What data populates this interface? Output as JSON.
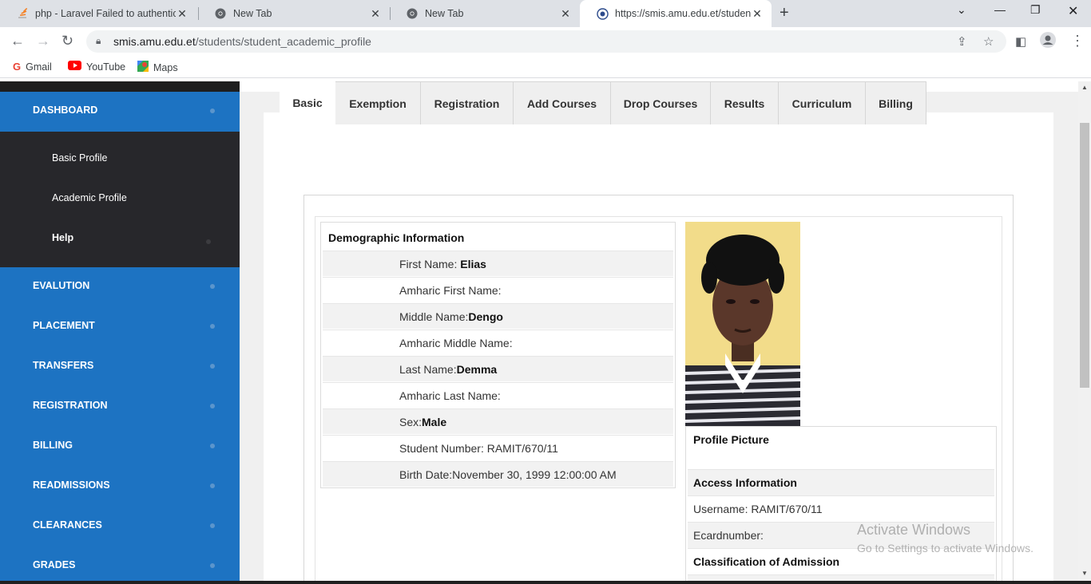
{
  "browser": {
    "tabs": [
      {
        "title": "php - Laravel Failed to authenticat",
        "active": false
      },
      {
        "title": "New Tab",
        "active": false
      },
      {
        "title": "New Tab",
        "active": false
      },
      {
        "title": "https://smis.amu.edu.et/students",
        "active": true
      }
    ],
    "url_host": "smis.amu.edu.et",
    "url_path": "/students/student_academic_profile",
    "bookmarks": [
      {
        "label": "Gmail",
        "icon": "google-icon"
      },
      {
        "label": "YouTube",
        "icon": "youtube-icon"
      },
      {
        "label": "Maps",
        "icon": "maps-icon"
      }
    ]
  },
  "sidebar": {
    "dashboard": "DASHBOARD",
    "sub_items": [
      "Basic Profile",
      "Academic Profile",
      "Help"
    ],
    "items": [
      "EVALUTION",
      "PLACEMENT",
      "TRANSFERS",
      "REGISTRATION",
      "BILLING",
      "READMISSIONS",
      "CLEARANCES",
      "GRADES"
    ]
  },
  "tabs": [
    "Basic",
    "Exemption",
    "Registration",
    "Add Courses",
    "Drop Courses",
    "Results",
    "Curriculum",
    "Billing"
  ],
  "demographic": {
    "heading": "Demographic Information",
    "rows": [
      {
        "label": "First Name: ",
        "value": "Elias"
      },
      {
        "label": "Amharic First Name:",
        "value": ""
      },
      {
        "label": "Middle Name:",
        "value": "Dengo"
      },
      {
        "label": "Amharic Middle Name:",
        "value": ""
      },
      {
        "label": "Last Name:",
        "value": "Demma"
      },
      {
        "label": "Amharic Last Name:",
        "value": ""
      },
      {
        "label": "Sex:",
        "value": "Male"
      },
      {
        "label": "Student Number: RAMIT/670/11",
        "value": ""
      },
      {
        "label": "Birth Date:November 30, 1999 12:00:00 AM",
        "value": ""
      }
    ]
  },
  "profile": {
    "picture_label": "Profile Picture",
    "access_heading": "Access Information",
    "username": "Username: RAMIT/670/11",
    "ecard": "Ecardnumber:",
    "classification_heading": "Classification of Admission"
  },
  "watermark": {
    "line1": "Activate Windows",
    "line2": "Go to Settings to activate Windows."
  },
  "colors": {
    "sidebar_blue": "#1d73c2",
    "sidebar_dark": "#27272b",
    "tab_bg": "#efefef"
  }
}
